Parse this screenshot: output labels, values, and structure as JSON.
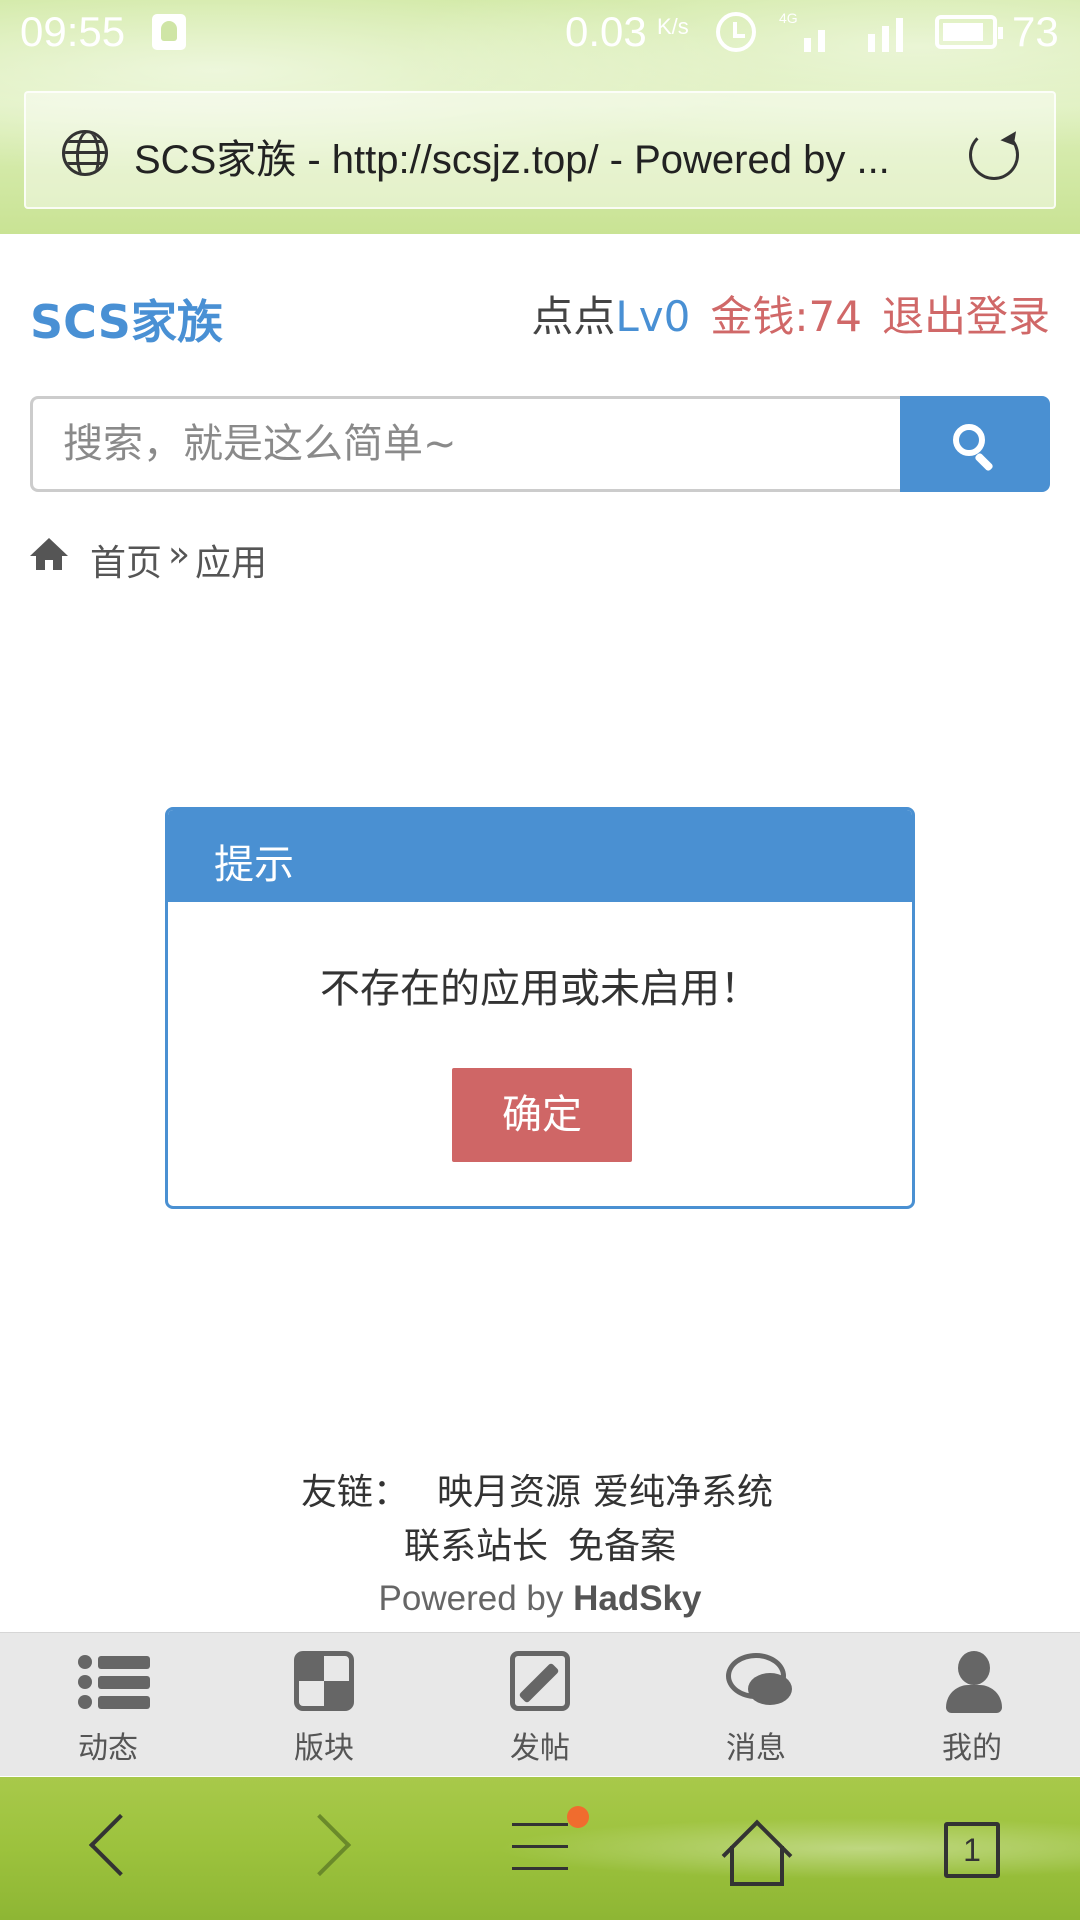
{
  "status_bar": {
    "time": "09:55",
    "net_speed": "0.03",
    "net_speed_unit": "K/s",
    "network_type": "4G",
    "battery_level": "73"
  },
  "browser": {
    "page_title": "SCS家族 - http://scsjz.top/ - Powered by ...",
    "tab_count": "1"
  },
  "site": {
    "logo": "SCS家族",
    "user": {
      "name": "点点",
      "level": "Lv0",
      "money": "金钱:74",
      "logout": "退出登录"
    }
  },
  "search": {
    "placeholder": "搜索，就是这么简单~"
  },
  "breadcrumb": {
    "home": "首页",
    "separator": "»",
    "current": "应用"
  },
  "dialog": {
    "title": "提示",
    "message": "不存在的应用或未启用！",
    "ok_label": "确定"
  },
  "footer": {
    "links_label": "友链：",
    "links": [
      "映月资源",
      "爱纯净系统"
    ],
    "contact": "联系站长",
    "icp": "免备案",
    "powered_prefix": "Powered by",
    "powered_brand": "HadSky"
  },
  "app_nav": [
    {
      "label": "动态",
      "icon": "list-icon"
    },
    {
      "label": "版块",
      "icon": "board-icon"
    },
    {
      "label": "发帖",
      "icon": "edit-icon"
    },
    {
      "label": "消息",
      "icon": "chat-icon"
    },
    {
      "label": "我的",
      "icon": "user-icon"
    }
  ],
  "colors": {
    "brand_blue": "#4a90d2",
    "accent_red": "#cf6666"
  }
}
